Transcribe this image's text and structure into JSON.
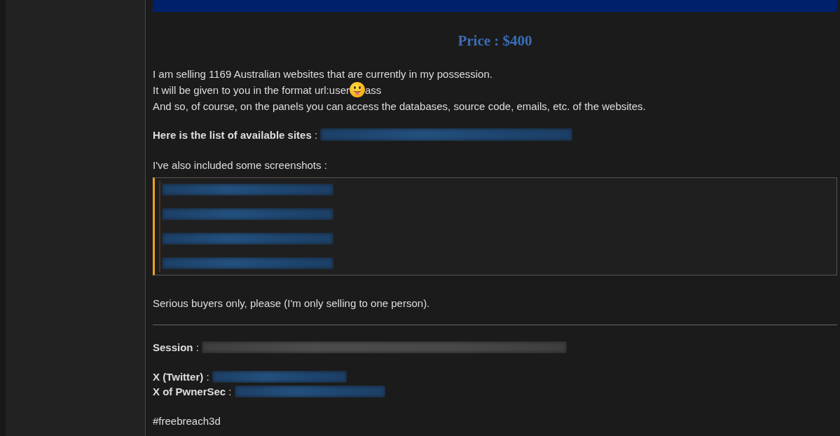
{
  "post": {
    "price": "Price : $400",
    "intro_lines": [
      {
        "segments": [
          {
            "kind": "text",
            "text": "I am selling 1169 Australian websites that are currently in my possession."
          }
        ]
      },
      {
        "segments": [
          {
            "kind": "text",
            "text": "It will be given to you in the format url:user"
          },
          {
            "kind": "emoji"
          },
          {
            "kind": "text",
            "text": "ass"
          }
        ]
      },
      {
        "segments": [
          {
            "kind": "text",
            "text": "And so, of course, on the panels you can access the databases, source code, emails, etc. of the websites."
          }
        ]
      }
    ],
    "sites": {
      "label": "**Here is the list of available sites** :",
      "value": {
        "kind": "blurred_link"
      }
    },
    "screenshots": {
      "intro": "I've also included some screenshots :",
      "quote": [
        {
          "kind": "blurred_link"
        },
        {
          "kind": "blurred_link"
        },
        {
          "kind": "blurred_link"
        },
        {
          "kind": "blurred_link"
        }
      ]
    },
    "notice": "Serious buyers only, please (I'm only selling to one person).",
    "contacts": [
      {
        "label": "**Session** :",
        "value": {
          "kind": "blurred_text"
        }
      },
      {
        "label": "**X (Twitter)** :",
        "value": {
          "kind": "blurred_link"
        }
      },
      {
        "label": "**X of PwnerSec** :",
        "value": {
          "kind": "blurred_link"
        }
      }
    ],
    "hashtag": "#freebreach3d"
  }
}
